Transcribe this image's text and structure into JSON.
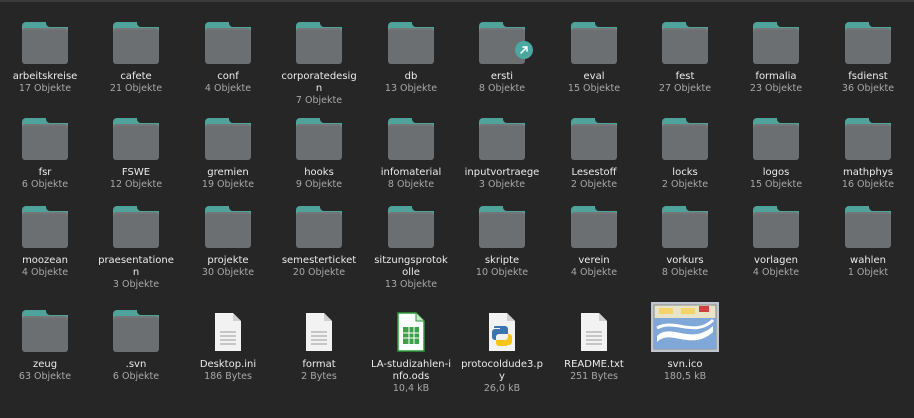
{
  "items": [
    {
      "name": "arbeitskreise",
      "sub": "17 Objekte",
      "icon": "folder-icon"
    },
    {
      "name": "cafete",
      "sub": "21 Objekte",
      "icon": "folder-icon"
    },
    {
      "name": "conf",
      "sub": "4 Objekte",
      "icon": "folder-icon"
    },
    {
      "name": "corporatedesig n",
      "sub": "7 Objekte",
      "icon": "folder-icon"
    },
    {
      "name": "db",
      "sub": "13 Objekte",
      "icon": "folder-icon"
    },
    {
      "name": "ersti",
      "sub": "8 Objekte",
      "icon": "folder-link-icon"
    },
    {
      "name": "eval",
      "sub": "15 Objekte",
      "icon": "folder-icon"
    },
    {
      "name": "fest",
      "sub": "27 Objekte",
      "icon": "folder-icon"
    },
    {
      "name": "formalia",
      "sub": "23 Objekte",
      "icon": "folder-icon"
    },
    {
      "name": "fsdienst",
      "sub": "36 Objekte",
      "icon": "folder-icon"
    },
    {
      "name": "fsr",
      "sub": "6 Objekte",
      "icon": "folder-icon"
    },
    {
      "name": "FSWE",
      "sub": "12 Objekte",
      "icon": "folder-icon"
    },
    {
      "name": "gremien",
      "sub": "19 Objekte",
      "icon": "folder-icon"
    },
    {
      "name": "hooks",
      "sub": "9 Objekte",
      "icon": "folder-icon"
    },
    {
      "name": "infomaterial",
      "sub": "8 Objekte",
      "icon": "folder-icon"
    },
    {
      "name": "inputvortraege",
      "sub": "3 Objekte",
      "icon": "folder-icon"
    },
    {
      "name": "Lesestoff",
      "sub": "2 Objekte",
      "icon": "folder-icon"
    },
    {
      "name": "locks",
      "sub": "2 Objekte",
      "icon": "folder-icon"
    },
    {
      "name": "logos",
      "sub": "15 Objekte",
      "icon": "folder-icon"
    },
    {
      "name": "mathphys",
      "sub": "16 Objekte",
      "icon": "folder-icon"
    },
    {
      "name": "moozean",
      "sub": "4 Objekte",
      "icon": "folder-icon"
    },
    {
      "name": "praesentatione n",
      "sub": "3 Objekte",
      "icon": "folder-icon"
    },
    {
      "name": "projekte",
      "sub": "30 Objekte",
      "icon": "folder-icon"
    },
    {
      "name": "semesterticket",
      "sub": "20 Objekte",
      "icon": "folder-icon"
    },
    {
      "name": "sitzungsprotok olle",
      "sub": "13 Objekte",
      "icon": "folder-icon"
    },
    {
      "name": "skripte",
      "sub": "10 Objekte",
      "icon": "folder-icon"
    },
    {
      "name": "verein",
      "sub": "4 Objekte",
      "icon": "folder-icon"
    },
    {
      "name": "vorkurs",
      "sub": "8 Objekte",
      "icon": "folder-icon"
    },
    {
      "name": "vorlagen",
      "sub": "4 Objekte",
      "icon": "folder-icon"
    },
    {
      "name": "wahlen",
      "sub": "1 Objekt",
      "icon": "folder-icon"
    },
    {
      "name": "zeug",
      "sub": "63 Objekte",
      "icon": "folder-icon"
    },
    {
      "name": ".svn",
      "sub": "6 Objekte",
      "icon": "folder-icon"
    },
    {
      "name": "Desktop.ini",
      "sub": "186 Bytes",
      "icon": "text-file-icon"
    },
    {
      "name": "format",
      "sub": "2 Bytes",
      "icon": "text-file-icon"
    },
    {
      "name": "LA-studizahlen-info.ods",
      "sub": "10,4 kB",
      "icon": "spreadsheet-file-icon"
    },
    {
      "name": "protocoldude3.py",
      "sub": "26,0 kB",
      "icon": "python-file-icon"
    },
    {
      "name": "README.txt",
      "sub": "251 Bytes",
      "icon": "text-file-icon"
    },
    {
      "name": "svn.ico",
      "sub": "180,5 kB",
      "icon": "image-thumbnail-icon"
    }
  ],
  "colors": {
    "background": "#262626",
    "folder_tab": "#4fa39a",
    "folder_body": "#6c6f72",
    "text_primary": "#ececec",
    "text_secondary": "#a8a8a8"
  }
}
